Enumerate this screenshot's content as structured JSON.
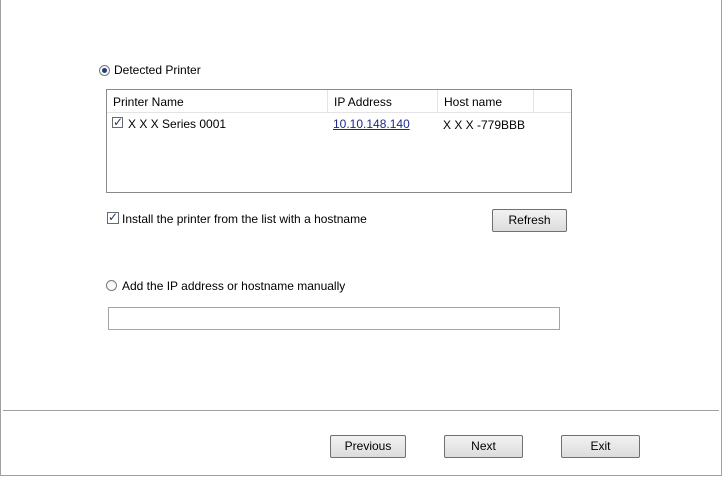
{
  "colors": {
    "accent_bar": "#d3162c",
    "link": "#1a2a8c"
  },
  "detected_option": {
    "label": "Detected Printer",
    "selected": true
  },
  "printer_list": {
    "columns": [
      "Printer Name",
      "IP Address",
      "Host name"
    ],
    "rows": [
      {
        "checked": true,
        "name": "X X X  Series 0001",
        "ip": "10.10.148.140",
        "host": "X X X -779BBB"
      }
    ]
  },
  "hostname_option": {
    "label": "Install the printer from the list with a hostname",
    "checked": true
  },
  "refresh_label": "Refresh",
  "manual_option": {
    "label": "Add the IP address or hostname manually",
    "selected": false
  },
  "manual_input": {
    "value": "",
    "placeholder": ""
  },
  "footer": {
    "previous_label": "Previous",
    "next_label": "Next",
    "exit_label": "Exit"
  }
}
